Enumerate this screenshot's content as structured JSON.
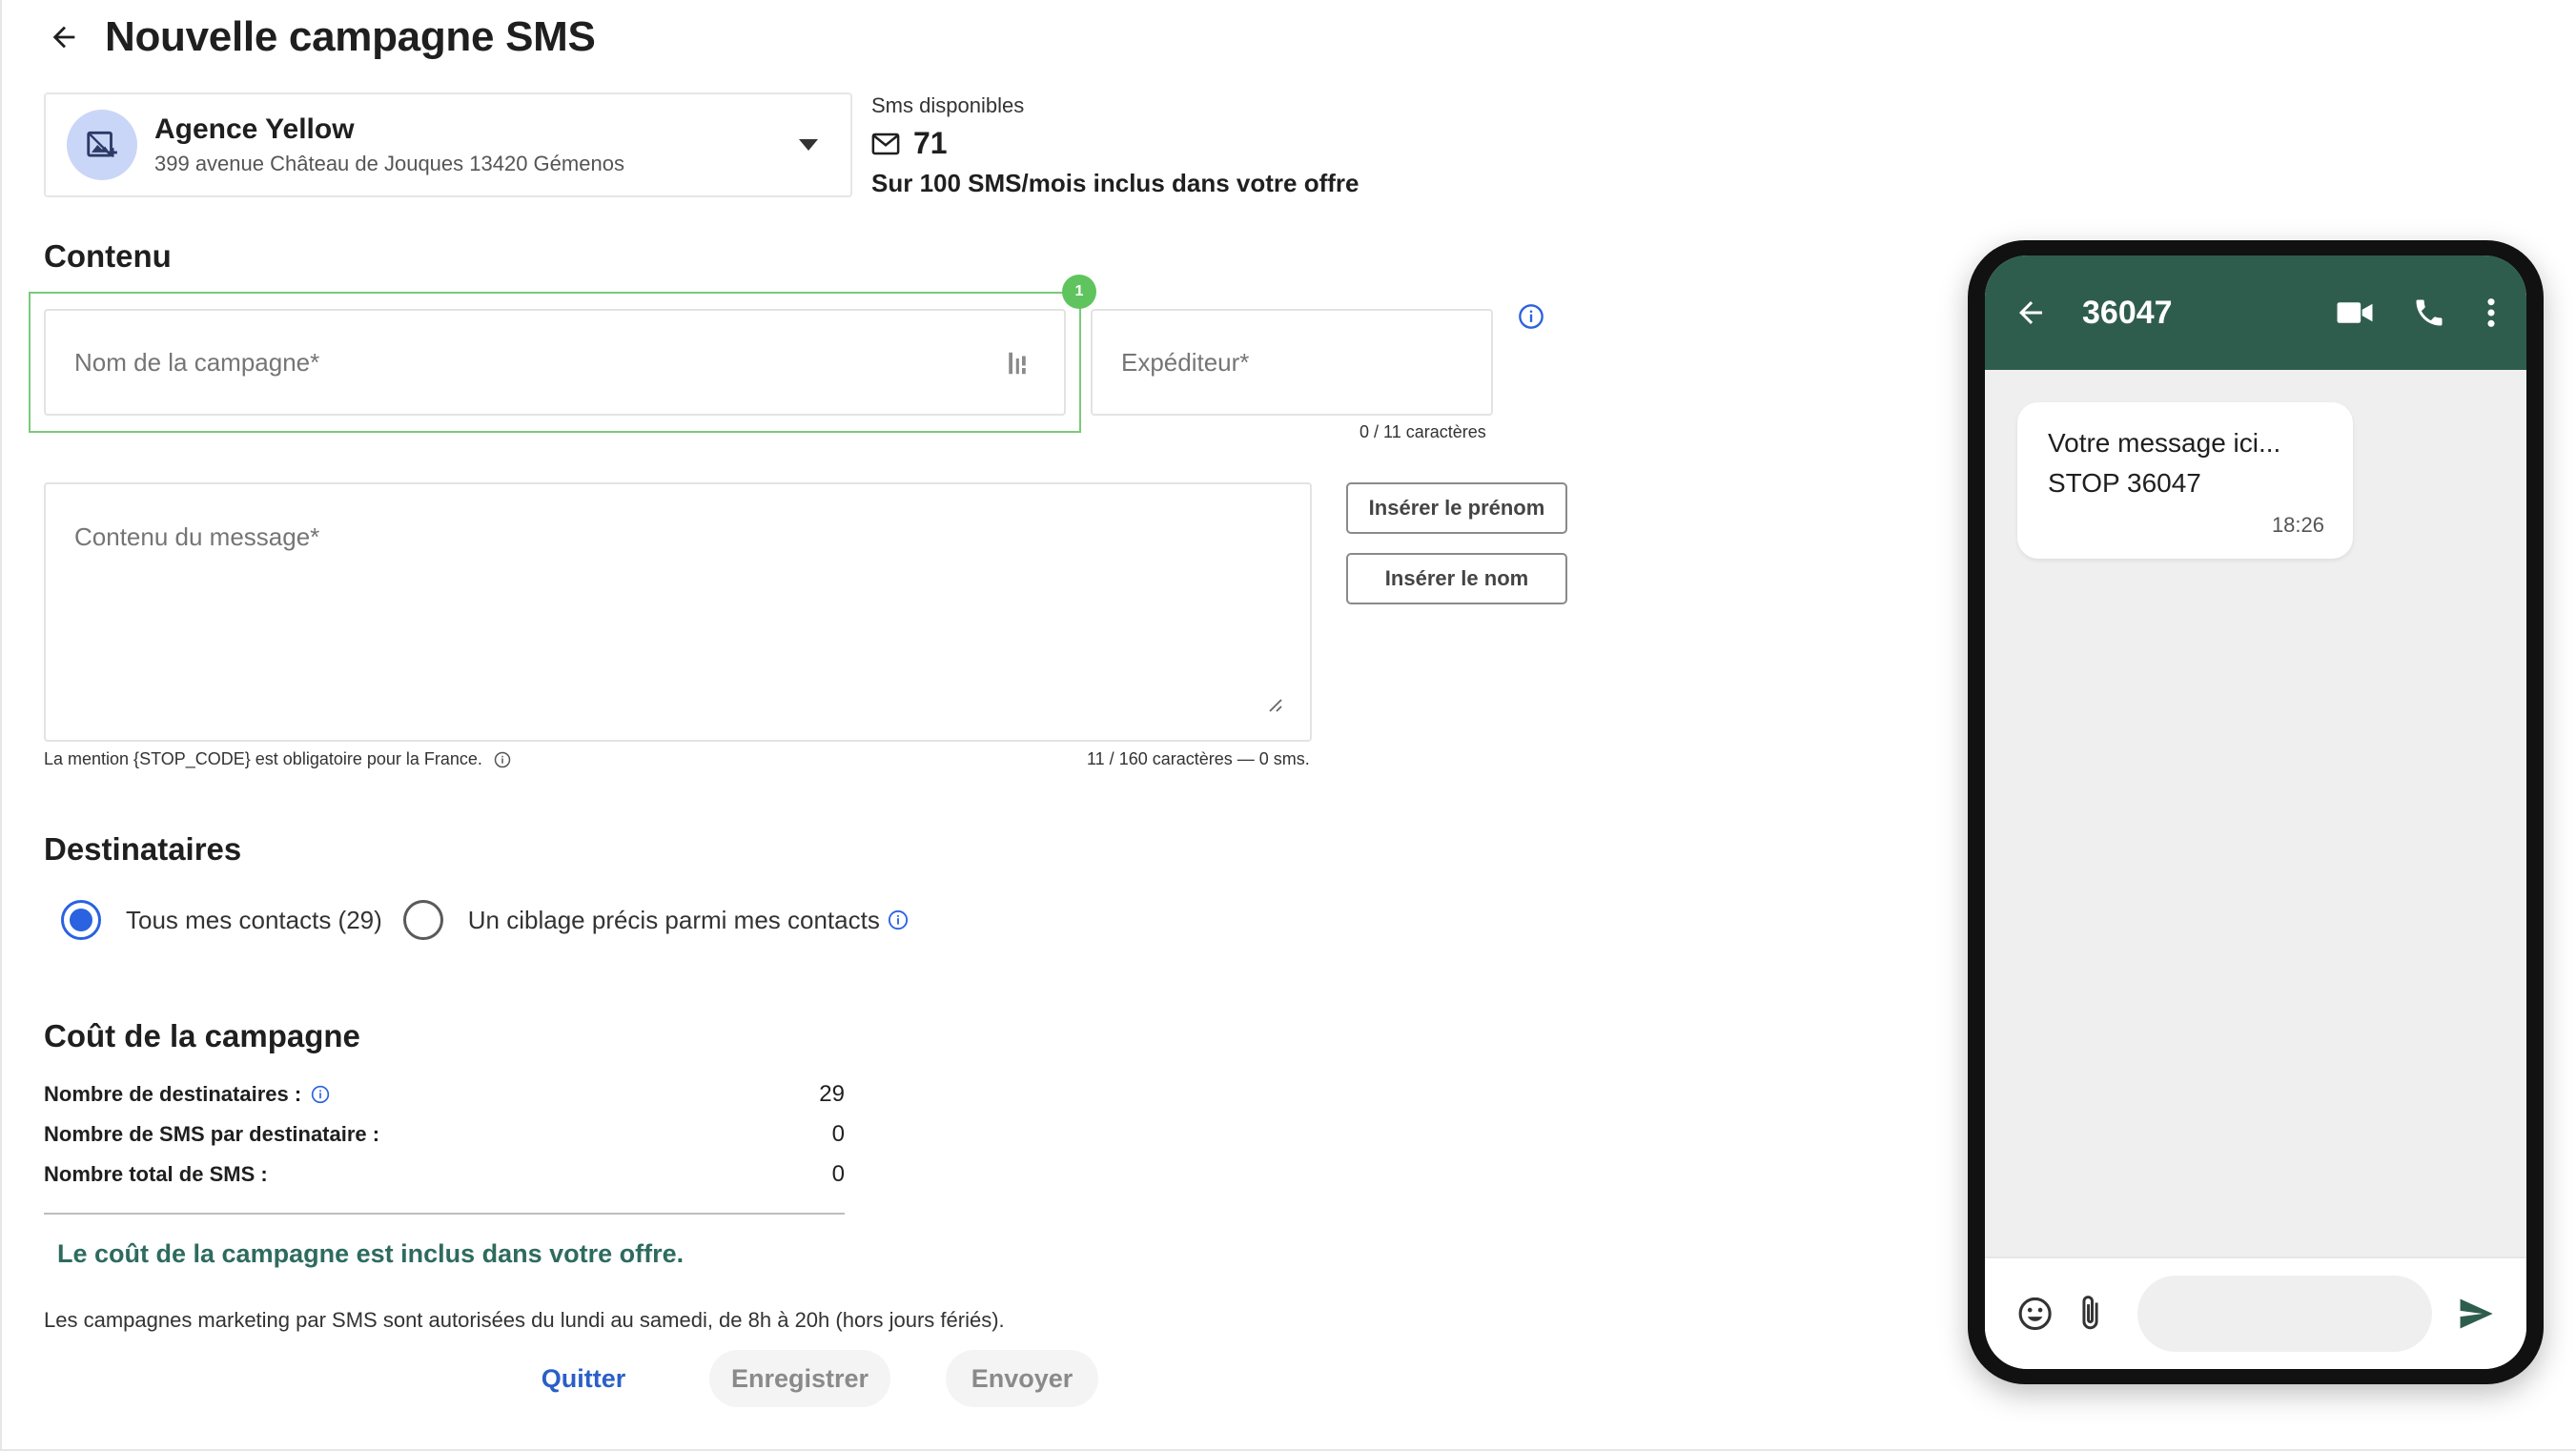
{
  "header": {
    "title": "Nouvelle campagne SMS"
  },
  "agency": {
    "name": "Agence Yellow",
    "address": "399 avenue Château de Jouques 13420 Gémenos"
  },
  "sms_available": {
    "label": "Sms disponibles",
    "count": "71",
    "note": "Sur 100 SMS/mois inclus dans votre offre"
  },
  "content": {
    "title": "Contenu",
    "step_badge": "1",
    "campaign_name_placeholder": "Nom de la campagne*",
    "sender_placeholder": "Expéditeur*",
    "sender_char_count": "0 / 11 caractères",
    "message_placeholder": "Contenu du message*",
    "insert_firstname": "Insérer le prénom",
    "insert_lastname": "Insérer le nom",
    "mention": "La mention {STOP_CODE} est obligatoire pour la France.",
    "message_char_count": "11 / 160 caractères — 0 sms."
  },
  "recipients": {
    "title": "Destinataires",
    "option_all": "Tous mes contacts (29)",
    "option_targeted": "Un ciblage précis parmi mes contacts",
    "selected": "all"
  },
  "cost": {
    "title": "Coût de la campagne",
    "rows": [
      {
        "label": "Nombre de destinataires :",
        "value": "29",
        "info": true
      },
      {
        "label": "Nombre de SMS par destinataire :",
        "value": "0",
        "info": false
      },
      {
        "label": "Nombre total de SMS :",
        "value": "0",
        "info": false
      }
    ],
    "included": "Le coût de la campagne est inclus dans votre offre.",
    "legal": "Les campagnes marketing par SMS sont autorisées du lundi au samedi, de 8h à 20h (hors jours fériés)."
  },
  "actions": {
    "quit": "Quitter",
    "save": "Enregistrer",
    "send": "Envoyer"
  },
  "phone": {
    "number": "36047",
    "message_line1": "Votre message ici...",
    "message_line2": "STOP 36047",
    "time": "18:26"
  },
  "colors": {
    "accent": "#2a62e0",
    "phone_header": "#2f5d4d",
    "included_text": "#2e6b5f",
    "step_badge": "#5fc45e",
    "highlight": "#7cc97a"
  }
}
